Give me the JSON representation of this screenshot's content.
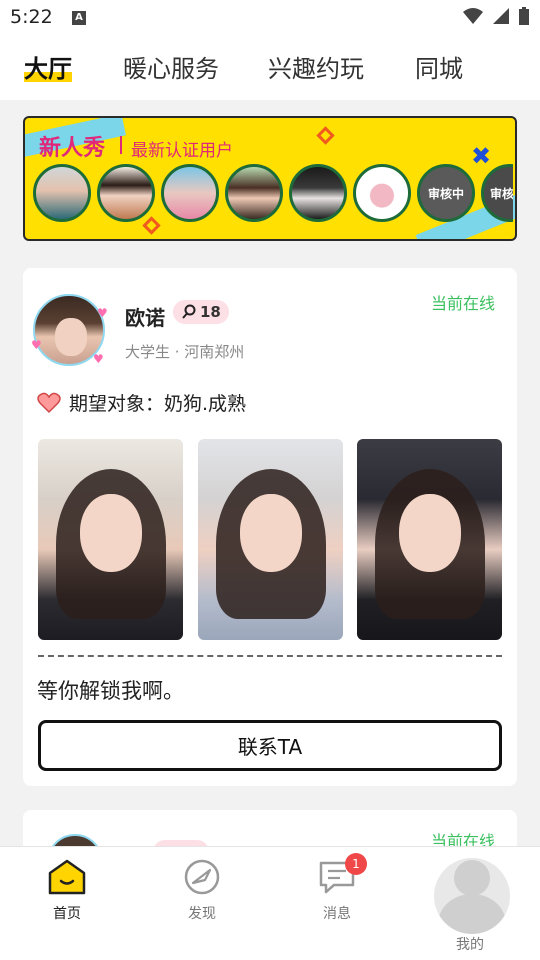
{
  "status_bar": {
    "time": "5:22",
    "notification_glyph": "A"
  },
  "top_tabs": [
    "大厅",
    "暖心服务",
    "兴趣约玩",
    "同城"
  ],
  "banner": {
    "title": "新人秀",
    "subtitle": "最新认证用户",
    "reviewing_label": "审核中",
    "reviewing_label_partial": "审核"
  },
  "card": {
    "name": "欧诺",
    "badge_count": "18",
    "sub": "大学生 · 河南郑州",
    "online": "当前在线",
    "expect": "期望对象：奶狗.成熟",
    "intro": "等你解锁我啊。",
    "contact_button": "联系TA"
  },
  "card2": {
    "online": "当前在线"
  },
  "bottom_nav": {
    "home": "首页",
    "discover": "发现",
    "messages": "消息",
    "messages_badge": "1",
    "me": "我的"
  },
  "colors": {
    "accent": "#ffd400",
    "online": "#3cc060",
    "banner_title": "#e0287a"
  }
}
